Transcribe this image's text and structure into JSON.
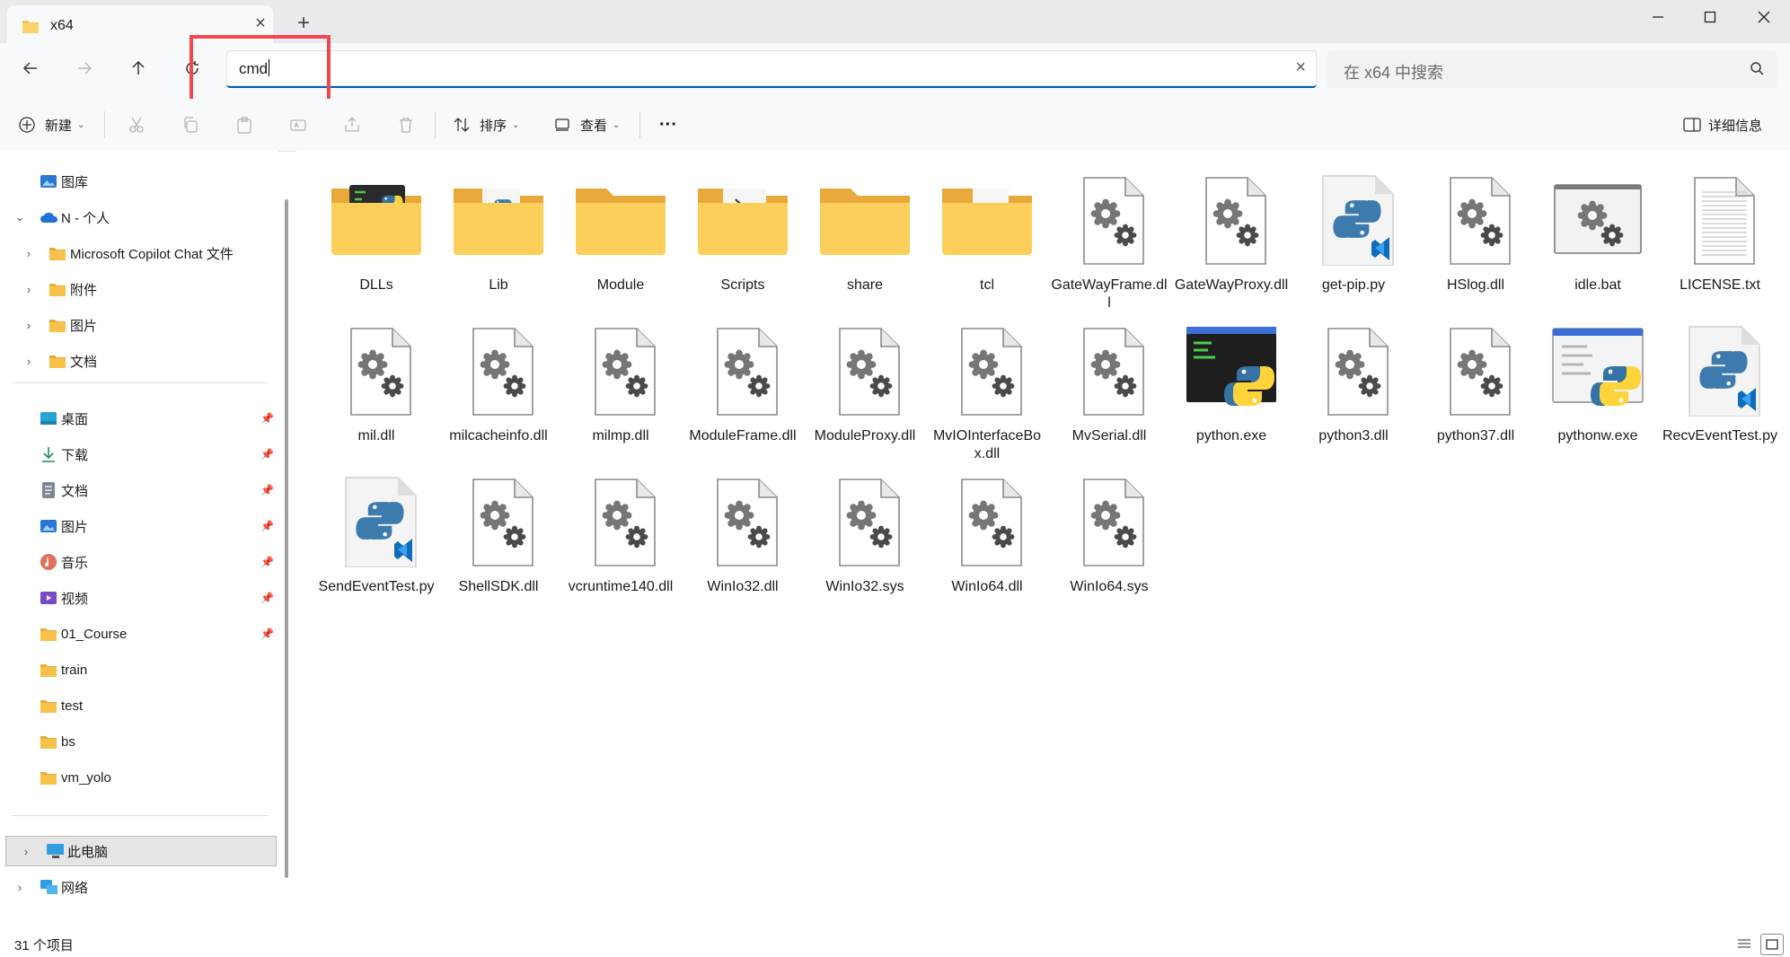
{
  "window": {
    "tab_title": "x64",
    "colors": {
      "accent": "#005fb8",
      "folder": "#f8c24a",
      "highlight": "#f0484e"
    }
  },
  "address": {
    "value": "cmd",
    "clear_icon": "close-icon"
  },
  "search": {
    "placeholder": "在 x64 中搜索"
  },
  "toolbar": {
    "new_label": "新建",
    "sort_label": "排序",
    "view_label": "查看",
    "more_label": "···",
    "details_label": "详细信息"
  },
  "sidebar": {
    "top": [
      {
        "label": "图库",
        "icon": "gallery-icon"
      },
      {
        "label": "N - 个人",
        "icon": "onedrive-icon"
      },
      {
        "label": "Microsoft Copilot Chat 文件",
        "icon": "folder-icon"
      },
      {
        "label": "附件",
        "icon": "folder-icon"
      },
      {
        "label": "图片",
        "icon": "folder-icon"
      },
      {
        "label": "文档",
        "icon": "folder-icon"
      }
    ],
    "quick": [
      {
        "label": "桌面",
        "icon": "desktop-icon"
      },
      {
        "label": "下载",
        "icon": "download-icon"
      },
      {
        "label": "文档",
        "icon": "documents-icon"
      },
      {
        "label": "图片",
        "icon": "pictures-icon"
      },
      {
        "label": "音乐",
        "icon": "music-icon"
      },
      {
        "label": "视频",
        "icon": "video-icon"
      },
      {
        "label": "01_Course",
        "icon": "folder-icon"
      },
      {
        "label": "train",
        "icon": "folder-icon"
      },
      {
        "label": "test",
        "icon": "folder-icon"
      },
      {
        "label": "bs",
        "icon": "folder-icon"
      },
      {
        "label": "vm_yolo",
        "icon": "folder-icon"
      }
    ],
    "bottom": [
      {
        "label": "此电脑",
        "icon": "this-pc-icon"
      },
      {
        "label": "网络",
        "icon": "network-icon"
      }
    ]
  },
  "files": [
    {
      "name": "DLLs",
      "icon": "folder-dlls"
    },
    {
      "name": "Lib",
      "icon": "folder-lib"
    },
    {
      "name": "Module",
      "icon": "folder"
    },
    {
      "name": "Scripts",
      "icon": "folder-scripts"
    },
    {
      "name": "share",
      "icon": "folder"
    },
    {
      "name": "tcl",
      "icon": "folder-tcl"
    },
    {
      "name": "GateWayFrame.dll",
      "icon": "dll"
    },
    {
      "name": "GateWayProxy.dll",
      "icon": "dll"
    },
    {
      "name": "get-pip.py",
      "icon": "py"
    },
    {
      "name": "HSlog.dll",
      "icon": "dll"
    },
    {
      "name": "idle.bat",
      "icon": "bat"
    },
    {
      "name": "LICENSE.txt",
      "icon": "txt"
    },
    {
      "name": "mil.dll",
      "icon": "dll"
    },
    {
      "name": "milcacheinfo.dll",
      "icon": "dll"
    },
    {
      "name": "milmp.dll",
      "icon": "dll"
    },
    {
      "name": "ModuleFrame.dll",
      "icon": "dll"
    },
    {
      "name": "ModuleProxy.dll",
      "icon": "dll"
    },
    {
      "name": "MvIOInterfaceBox.dll",
      "icon": "dll"
    },
    {
      "name": "MvSerial.dll",
      "icon": "dll"
    },
    {
      "name": "python.exe",
      "icon": "pyexe"
    },
    {
      "name": "python3.dll",
      "icon": "dll"
    },
    {
      "name": "python37.dll",
      "icon": "dll"
    },
    {
      "name": "pythonw.exe",
      "icon": "pywexe"
    },
    {
      "name": "RecvEventTest.py",
      "icon": "py"
    },
    {
      "name": "SendEventTest.py",
      "icon": "py"
    },
    {
      "name": "ShellSDK.dll",
      "icon": "dll"
    },
    {
      "name": "vcruntime140.dll",
      "icon": "dll"
    },
    {
      "name": "WinIo32.dll",
      "icon": "dll"
    },
    {
      "name": "WinIo32.sys",
      "icon": "dll"
    },
    {
      "name": "WinIo64.dll",
      "icon": "dll"
    },
    {
      "name": "WinIo64.sys",
      "icon": "dll"
    }
  ],
  "status": {
    "count": "31 个项目"
  }
}
